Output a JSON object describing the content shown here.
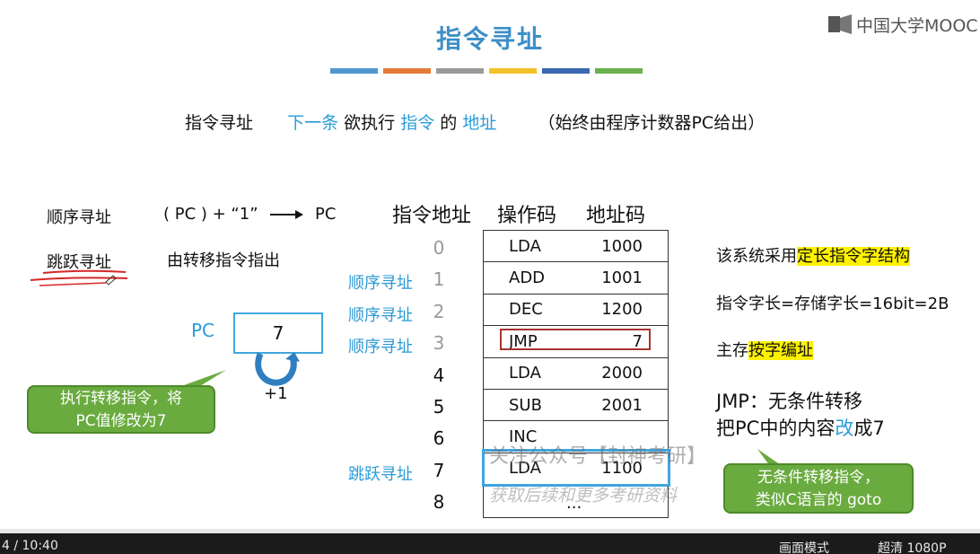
{
  "header": {
    "title": "指令寻址",
    "logo_text": "中国大学MOOC",
    "bar_colors": [
      "#4f97cf",
      "#e47a37",
      "#9a9a9a",
      "#f2c029",
      "#3b68b0",
      "#6ab04c"
    ]
  },
  "subtitle": {
    "lead": "指令寻址",
    "part1": "下一条",
    "part2": "欲执行",
    "part3": "指令",
    "part4": "的",
    "part5": "地址",
    "note": "（始终由程序计数器PC给出）"
  },
  "left": {
    "seq_label": "顺序寻址",
    "seq_formula_a": "( PC ) + “1”",
    "seq_formula_b": "PC",
    "jump_label": "跳跃寻址",
    "jump_desc": "由转移指令指出",
    "pc_label": "PC",
    "pc_value": "7",
    "plus_one": "+1",
    "callout": [
      "执行转移指令，将",
      "PC值修改为7"
    ]
  },
  "table": {
    "headers": [
      "指令地址",
      "操作码",
      "地址码"
    ],
    "addresses": [
      "0",
      "1",
      "2",
      "3",
      "4",
      "5",
      "6",
      "7",
      "8"
    ],
    "side_notes": [
      "",
      "顺序寻址",
      "顺序寻址",
      "顺序寻址",
      "",
      "",
      "",
      "跳跃寻址",
      ""
    ],
    "rows": [
      {
        "op": "LDA",
        "addr": "1000"
      },
      {
        "op": "ADD",
        "addr": "1001"
      },
      {
        "op": "DEC",
        "addr": "1200"
      },
      {
        "op": "JMP",
        "addr": "7"
      },
      {
        "op": "LDA",
        "addr": "2000"
      },
      {
        "op": "SUB",
        "addr": "2001"
      },
      {
        "op": "INC",
        "addr": ""
      },
      {
        "op": "LDA",
        "addr": "1100"
      },
      {
        "op": "...",
        "addr": ""
      }
    ]
  },
  "right": {
    "line1_a": "该系统采用",
    "line1_b": "定长指令字结构",
    "line2": "指令字长=存储字长=16bit=2B",
    "line3_a": "主存",
    "line3_b": "按字编址",
    "line4": "JMP：无条件转移",
    "line5_a": "把PC中的内容",
    "line5_b": "改",
    "line5_c": "成7",
    "callout": [
      "无条件转移指令，",
      "类似C语言的 goto"
    ]
  },
  "watermark": {
    "line1": "关注公众号【封神考研】",
    "line2": "获取后续和更多考研资料"
  },
  "player": {
    "time": "4 / 10:40",
    "mode": "画面模式",
    "quality": "超清 1080P"
  }
}
